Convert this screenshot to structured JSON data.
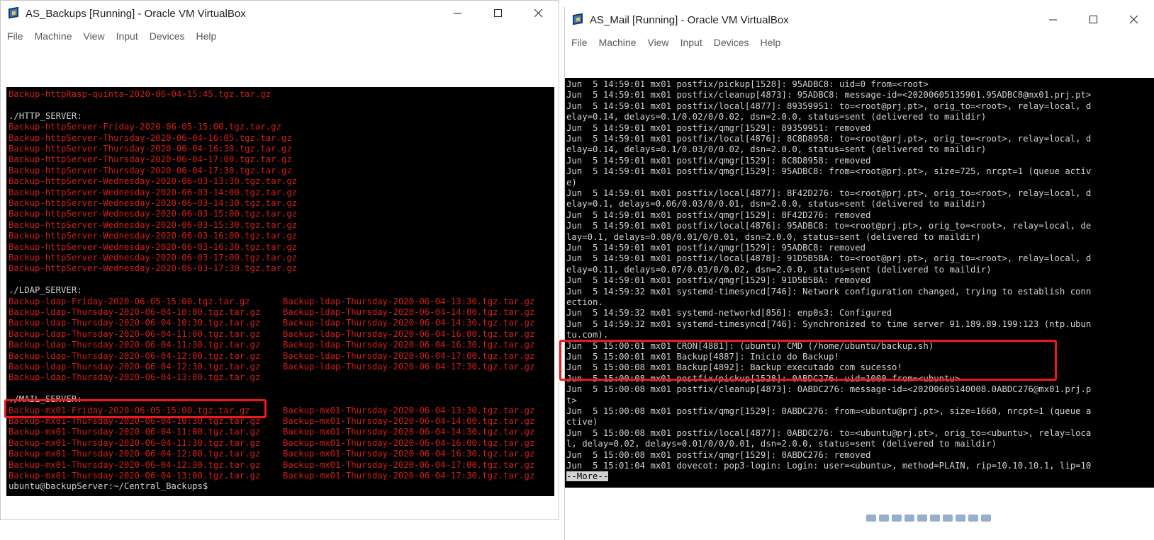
{
  "left_window": {
    "title": "AS_Backups [Running] - Oracle VM VirtualBox",
    "menu": [
      "File",
      "Machine",
      "View",
      "Input",
      "Devices",
      "Help"
    ],
    "console_lines": [
      {
        "text": "Backup-httpRasp-quinta-2020-06-04-15:45.tgz.tar.gz",
        "color": "red"
      },
      {
        "text": "",
        "color": "white"
      },
      {
        "text": "./HTTP_SERVER:",
        "color": "white"
      },
      {
        "text": "Backup-httpServer-Friday-2020-06-05-15:00.tgz.tar.gz",
        "color": "red"
      },
      {
        "text": "Backup-httpServer-Thursday-2020-06-04-16:05.tgz.tar.gz",
        "color": "red"
      },
      {
        "text": "Backup-httpServer-Thursday-2020-06-04-16:30.tgz.tar.gz",
        "color": "red"
      },
      {
        "text": "Backup-httpServer-Thursday-2020-06-04-17:00.tgz.tar.gz",
        "color": "red"
      },
      {
        "text": "Backup-httpServer-Thursday-2020-06-04-17:30.tgz.tar.gz",
        "color": "red"
      },
      {
        "text": "Backup-httpServer-Wednesday-2020-06-03-13:30.tgz.tar.gz",
        "color": "red"
      },
      {
        "text": "Backup-httpServer-Wednesday-2020-06-03-14:00.tgz.tar.gz",
        "color": "red"
      },
      {
        "text": "Backup-httpServer-Wednesday-2020-06-03-14:30.tgz.tar.gz",
        "color": "red"
      },
      {
        "text": "Backup-httpServer-Wednesday-2020-06-03-15:00.tgz.tar.gz",
        "color": "red"
      },
      {
        "text": "Backup-httpServer-Wednesday-2020-06-03-15:30.tgz.tar.gz",
        "color": "red"
      },
      {
        "text": "Backup-httpServer-Wednesday-2020-06-03-16:00.tgz.tar.gz",
        "color": "red"
      },
      {
        "text": "Backup-httpServer-Wednesday-2020-06-03-16:30.tgz.tar.gz",
        "color": "red"
      },
      {
        "text": "Backup-httpServer-Wednesday-2020-06-03-17:00.tgz.tar.gz",
        "color": "red"
      },
      {
        "text": "Backup-httpServer-Wednesday-2020-06-03-17:30.tgz.tar.gz",
        "color": "red"
      },
      {
        "text": "",
        "color": "white"
      },
      {
        "text": "./LDAP_SERVER:",
        "color": "white"
      },
      {
        "text": "Backup-ldap-Friday-2020-06-05-15:00.tgz.tar.gz",
        "col2": "Backup-ldap-Thursday-2020-06-04-13:30.tgz.tar.gz",
        "color": "red"
      },
      {
        "text": "Backup-ldap-Thursday-2020-06-04-10:00.tgz.tar.gz",
        "col2": "Backup-ldap-Thursday-2020-06-04-14:00.tgz.tar.gz",
        "color": "red"
      },
      {
        "text": "Backup-ldap-Thursday-2020-06-04-10:30.tgz.tar.gz",
        "col2": "Backup-ldap-Thursday-2020-06-04-14:30.tgz.tar.gz",
        "color": "red"
      },
      {
        "text": "Backup-ldap-Thursday-2020-06-04-11:00.tgz.tar.gz",
        "col2": "Backup-ldap-Thursday-2020-06-04-16:00.tgz.tar.gz",
        "color": "red"
      },
      {
        "text": "Backup-ldap-Thursday-2020-06-04-11:30.tgz.tar.gz",
        "col2": "Backup-ldap-Thursday-2020-06-04-16:30.tgz.tar.gz",
        "color": "red"
      },
      {
        "text": "Backup-ldap-Thursday-2020-06-04-12:00.tgz.tar.gz",
        "col2": "Backup-ldap-Thursday-2020-06-04-17:00.tgz.tar.gz",
        "color": "red"
      },
      {
        "text": "Backup-ldap-Thursday-2020-06-04-12:30.tgz.tar.gz",
        "col2": "Backup-ldap-Thursday-2020-06-04-17:30.tgz.tar.gz",
        "color": "red"
      },
      {
        "text": "Backup-ldap-Thursday-2020-06-04-13:00.tgz.tar.gz",
        "color": "red"
      },
      {
        "text": "",
        "color": "white"
      },
      {
        "text": "./MAIL_SERVER:",
        "color": "white"
      },
      {
        "text": "Backup-mx01-Friday-2020-06-05-15:00.tgz.tar.gz",
        "col2": "Backup-mx01-Thursday-2020-06-04-13:30.tgz.tar.gz",
        "color": "red"
      },
      {
        "text": "Backup-mx01-Thursday-2020-06-04-10:30.tgz.tar.gz",
        "col2": "Backup-mx01-Thursday-2020-06-04-14:00.tgz.tar.gz",
        "color": "red"
      },
      {
        "text": "Backup-mx01-Thursday-2020-06-04-11:00.tgz.tar.gz",
        "col2": "Backup-mx01-Thursday-2020-06-04-14:30.tgz.tar.gz",
        "color": "red"
      },
      {
        "text": "Backup-mx01-Thursday-2020-06-04-11:30.tgz.tar.gz",
        "col2": "Backup-mx01-Thursday-2020-06-04-16:00.tgz.tar.gz",
        "color": "red"
      },
      {
        "text": "Backup-mx01-Thursday-2020-06-04-12:00.tgz.tar.gz",
        "col2": "Backup-mx01-Thursday-2020-06-04-16:30.tgz.tar.gz",
        "color": "red"
      },
      {
        "text": "Backup-mx01-Thursday-2020-06-04-12:30.tgz.tar.gz",
        "col2": "Backup-mx01-Thursday-2020-06-04-17:00.tgz.tar.gz",
        "color": "red"
      },
      {
        "text": "Backup-mx01-Thursday-2020-06-04-13:00.tgz.tar.gz",
        "col2": "Backup-mx01-Thursday-2020-06-04-17:30.tgz.tar.gz",
        "color": "red"
      },
      {
        "text": "ubuntu@backupServer:~/Central_Backups$",
        "color": "white"
      }
    ]
  },
  "right_window": {
    "title": "AS_Mail [Running] - Oracle VM VirtualBox",
    "menu": [
      "File",
      "Machine",
      "View",
      "Input",
      "Devices",
      "Help"
    ],
    "console_lines": [
      "Jun  5 14:59:01 mx01 postfix/pickup[1528]: 95ADBC8: uid=0 from=<root>",
      "Jun  5 14:59:01 mx01 postfix/cleanup[4873]: 95ADBC8: message-id=<20200605135901.95ADBC8@mx01.prj.pt>",
      "Jun  5 14:59:01 mx01 postfix/local[4877]: 89359951: to=<root@prj.pt>, orig_to=<root>, relay=local, d",
      "elay=0.14, delays=0.1/0.02/0/0.02, dsn=2.0.0, status=sent (delivered to maildir)",
      "Jun  5 14:59:01 mx01 postfix/qmgr[1529]: 89359951: removed",
      "Jun  5 14:59:01 mx01 postfix/local[4876]: 8C8D8958: to=<root@prj.pt>, orig_to=<root>, relay=local, d",
      "elay=0.14, delays=0.1/0.03/0/0.02, dsn=2.0.0, status=sent (delivered to maildir)",
      "Jun  5 14:59:01 mx01 postfix/qmgr[1529]: 8C8D8958: removed",
      "Jun  5 14:59:01 mx01 postfix/qmgr[1529]: 95ADBC8: from=<root@prj.pt>, size=725, nrcpt=1 (queue activ",
      "e)",
      "Jun  5 14:59:01 mx01 postfix/local[4877]: 8F42D276: to=<root@prj.pt>, orig_to=<root>, relay=local, d",
      "elay=0.1, delays=0.06/0.03/0/0.01, dsn=2.0.0, status=sent (delivered to maildir)",
      "Jun  5 14:59:01 mx01 postfix/qmgr[1529]: 8F42D276: removed",
      "Jun  5 14:59:01 mx01 postfix/local[4876]: 95ADBC8: to=<root@prj.pt>, orig_to=<root>, relay=local, de",
      "lay=0.1, delays=0.08/0.01/0/0.01, dsn=2.0.0, status=sent (delivered to maildir)",
      "Jun  5 14:59:01 mx01 postfix/qmgr[1529]: 95ADBC8: removed",
      "Jun  5 14:59:01 mx01 postfix/local[4878]: 91D5B5BA: to=<root@prj.pt>, orig_to=<root>, relay=local, d",
      "elay=0.11, delays=0.07/0.03/0/0.02, dsn=2.0.0, status=sent (delivered to maildir)",
      "Jun  5 14:59:01 mx01 postfix/qmgr[1529]: 91D5B5BA: removed",
      "Jun  5 14:59:32 mx01 systemd-timesyncd[746]: Network configuration changed, trying to establish conn",
      "ection.",
      "Jun  5 14:59:32 mx01 systemd-networkd[856]: enp0s3: Configured",
      "Jun  5 14:59:32 mx01 systemd-timesyncd[746]: Synchronized to time server 91.189.89.199:123 (ntp.ubun",
      "tu.com).",
      "Jun  5 15:00:01 mx01 CRON[4881]: (ubuntu) CMD (/home/ubuntu/backup.sh)",
      "Jun  5 15:00:01 mx01 Backup[4887]: Inicio do Backup!",
      "Jun  5 15:00:08 mx01 Backup[4892]: Backup executado com sucesso!",
      "Jun  5 15:00:08 mx01 postfix/pickup[1528]: 0ABDC276: uid=1000 from=<ubuntu>",
      "Jun  5 15:00:08 mx01 postfix/cleanup[4873]: 0ABDC276: message-id=<20200605140008.0ABDC276@mx01.prj.p",
      "t>",
      "Jun  5 15:00:08 mx01 postfix/qmgr[1529]: 0ABDC276: from=<ubuntu@prj.pt>, size=1660, nrcpt=1 (queue a",
      "ctive)",
      "Jun  5 15:00:08 mx01 postfix/local[4877]: 0ABDC276: to=<ubuntu@prj.pt>, orig_to=<ubuntu>, relay=loca",
      "l, delay=0.02, delays=0.01/0/0/0.01, dsn=2.0.0, status=sent (delivered to maildir)",
      "Jun  5 15:00:08 mx01 postfix/qmgr[1529]: 0ABDC276: removed",
      "Jun  5 15:01:04 mx01 dovecot: pop3-login: Login: user=<ubuntu>, method=PLAIN, rip=10.10.10.1, lip=10"
    ],
    "pager_prompt": "--More--"
  },
  "colors": {
    "terminal_bg": "#000000",
    "terminal_red": "#d51d1d",
    "terminal_white": "#d2d2d2",
    "annotation_red": "#ee1a1a"
  }
}
